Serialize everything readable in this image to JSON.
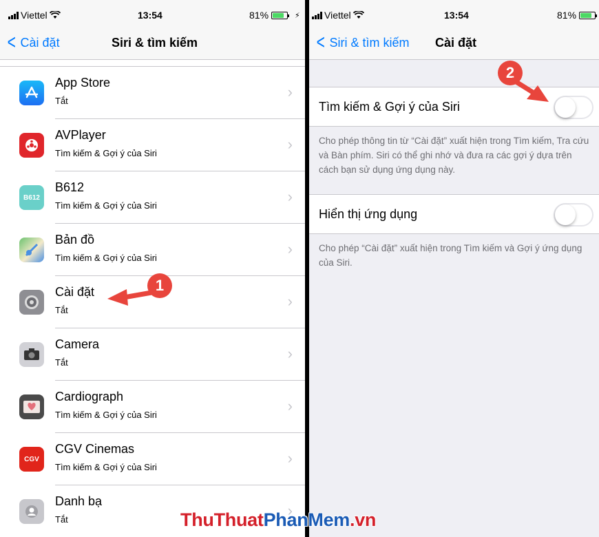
{
  "status": {
    "carrier": "Viettel",
    "time": "13:54",
    "battery": "81%",
    "battery_level": 0.81,
    "battery_color": "#4cd964"
  },
  "left": {
    "back_label": "Cài đặt",
    "title": "Siri & tìm kiếm",
    "apps": [
      {
        "name": "App Store",
        "sub": "Tắt",
        "icon": "app-store-icon"
      },
      {
        "name": "AVPlayer",
        "sub": "Tìm kiếm & Gợi ý của Siri",
        "icon": "avplayer-icon"
      },
      {
        "name": "B612",
        "sub": "Tìm kiếm & Gợi ý của Siri",
        "icon": "b612-icon",
        "icon_text": "B612"
      },
      {
        "name": "Bản đồ",
        "sub": "Tìm kiếm & Gợi ý của Siri",
        "icon": "maps-icon"
      },
      {
        "name": "Cài đặt",
        "sub": "Tắt",
        "icon": "settings-gear-icon"
      },
      {
        "name": "Camera",
        "sub": "Tắt",
        "icon": "camera-icon"
      },
      {
        "name": "Cardiograph",
        "sub": "Tìm kiếm & Gợi ý của Siri",
        "icon": "cardiograph-icon"
      },
      {
        "name": "CGV Cinemas",
        "sub": "Tìm kiếm & Gợi ý của Siri",
        "icon": "cgv-icon",
        "icon_text": "CGV"
      },
      {
        "name": "Danh bạ",
        "sub": "Tắt",
        "icon": "contacts-icon"
      }
    ]
  },
  "right": {
    "back_label": "Siri & tìm kiếm",
    "title": "Cài đặt",
    "toggle1_label": "Tìm kiếm & Gợi ý của Siri",
    "toggle1_on": false,
    "desc1": "Cho phép thông tin từ “Cài đặt” xuất hiện trong Tìm kiếm, Tra cứu và Bàn phím. Siri có thể ghi nhớ và đưa ra các gợi ý dựa trên cách bạn sử dụng ứng dụng này.",
    "toggle2_label": "Hiển thị ứng dụng",
    "toggle2_on": false,
    "desc2": "Cho phép “Cài đặt” xuất hiện trong Tìm kiếm và Gợi ý ứng dụng của Siri."
  },
  "annotations": {
    "step1": "1",
    "step2": "2",
    "accent": "#e8453c"
  },
  "watermark": {
    "part1": "ThuThuat",
    "part2": "PhanMem",
    "part3": ".vn"
  },
  "colors": {
    "ios_blue": "#007aff",
    "separator": "#c8c7cc",
    "grouped_bg": "#efeff4"
  }
}
